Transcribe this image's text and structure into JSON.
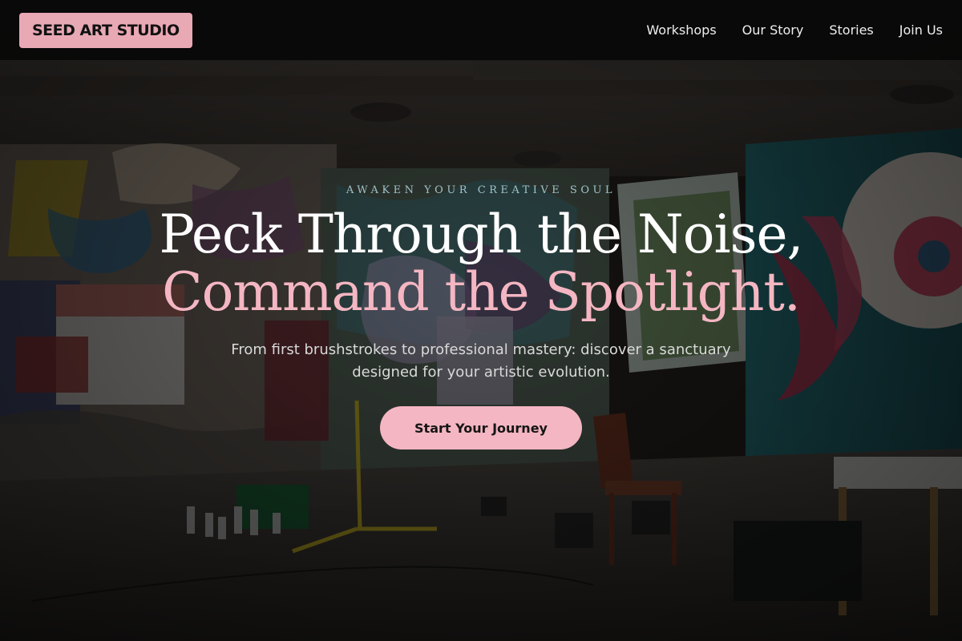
{
  "brand": {
    "logo_text": "SEED ART STUDIO"
  },
  "nav": {
    "items": [
      {
        "label": "Workshops"
      },
      {
        "label": "Our Story"
      },
      {
        "label": "Stories"
      },
      {
        "label": "Join Us"
      }
    ]
  },
  "hero": {
    "eyebrow": "AWAKEN YOUR CREATIVE SOUL",
    "headline_line1": "Peck Through the Noise,",
    "headline_line2": "Command the Spotlight.",
    "subtitle": "From first brushstrokes to professional mastery: discover a sanctuary designed for your artistic evolution.",
    "cta_label": "Start Your Journey",
    "background_image": "graffiti-art-studio-photo"
  },
  "colors": {
    "accent_pink": "#f4b6c2",
    "brand_pink": "#e8a8b4",
    "eyebrow_teal": "#9fc2c9",
    "topbar_bg": "#080808"
  }
}
